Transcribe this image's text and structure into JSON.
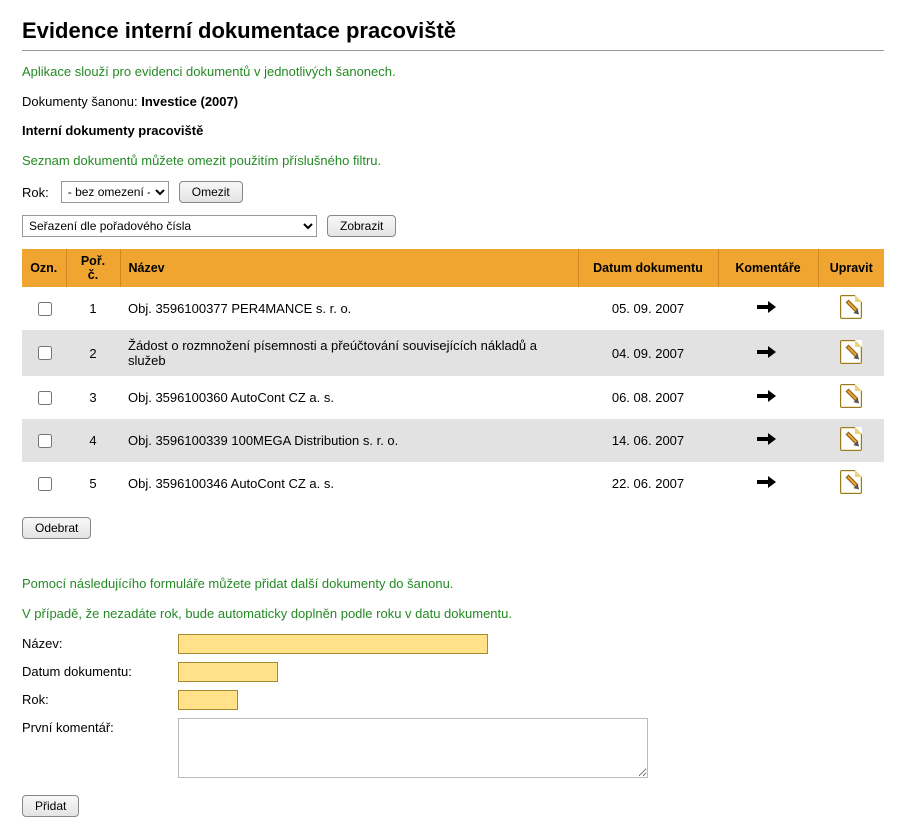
{
  "page_title": "Evidence interní dokumentace pracoviště",
  "intro_text": "Aplikace slouží pro evidenci dokumentů v jednotlivých šanonech.",
  "sanon_prefix": "Dokumenty šanonu: ",
  "sanon_name": "Investice (2007)",
  "section_heading": "Interní dokumenty pracoviště",
  "filter_hint": "Seznam dokumentů můžete omezit použitím příslušného filtru.",
  "filter": {
    "year_label": "Rok:",
    "year_selected": "- bez omezení -",
    "limit_button": "Omezit"
  },
  "sort": {
    "selected": "Seřazení dle pořadového čísla",
    "show_button": "Zobrazit"
  },
  "table": {
    "headers": {
      "ozn": "Ozn.",
      "por": "Poř. č.",
      "nazev": "Název",
      "datum": "Datum dokumentu",
      "komentare": "Komentáře",
      "upravit": "Upravit"
    },
    "rows": [
      {
        "por": "1",
        "nazev": "Obj. 3596100377 PER4MANCE s. r. o.",
        "datum": "05. 09. 2007"
      },
      {
        "por": "2",
        "nazev": "Žádost o rozmnožení písemnosti a přeúčtování souvisejících nákladů a služeb",
        "datum": "04. 09. 2007"
      },
      {
        "por": "3",
        "nazev": "Obj. 3596100360 AutoCont CZ a. s.",
        "datum": "06. 08. 2007"
      },
      {
        "por": "4",
        "nazev": "Obj. 3596100339 100MEGA Distribution s. r. o.",
        "datum": "14. 06. 2007"
      },
      {
        "por": "5",
        "nazev": "Obj. 3596100346 AutoCont CZ a. s.",
        "datum": "22. 06. 2007"
      }
    ]
  },
  "remove_button": "Odebrat",
  "add_form": {
    "hint1": "Pomocí následujícího formuláře můžete přidat další dokumenty do šanonu.",
    "hint2": "V případě, že nezadáte rok, bude automaticky doplněn podle roku v datu dokumentu.",
    "labels": {
      "nazev": "Název:",
      "datum": "Datum dokumentu:",
      "rok": "Rok:",
      "komentar": "První komentář:"
    },
    "values": {
      "nazev": "",
      "datum": "",
      "rok": "",
      "komentar": ""
    },
    "submit": "Přidat"
  }
}
